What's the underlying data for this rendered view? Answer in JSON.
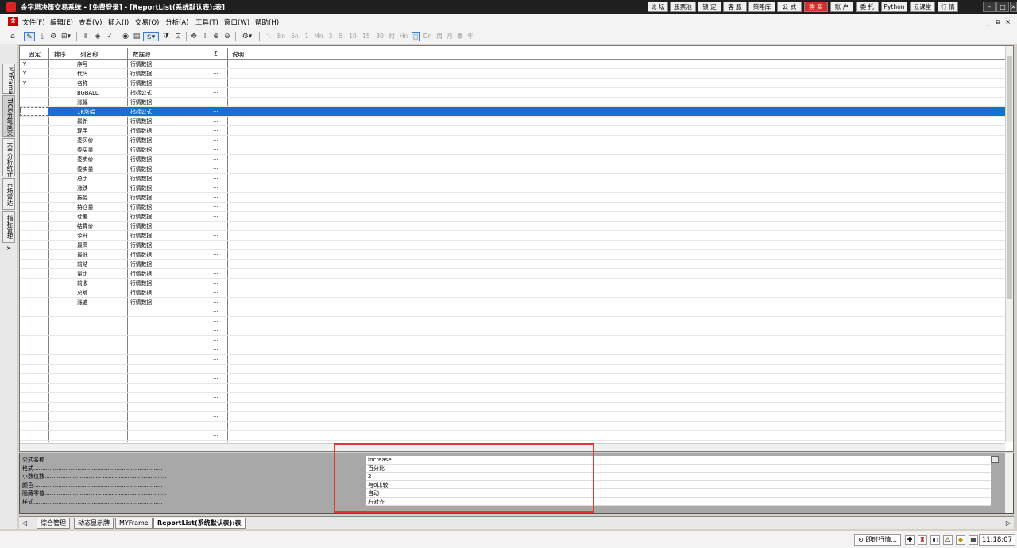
{
  "window": {
    "title": "金字塔决策交易系统 - [免费登录] - [ReportList(系统默认表):表]",
    "top_buttons": [
      "论 坛",
      "股票池",
      "锁 定",
      "客 服",
      "策略库",
      "公 式",
      "购 买",
      "账 户",
      "委 托",
      "Python",
      "云课堂",
      "行 情"
    ],
    "controls": [
      "–",
      "□",
      "×"
    ]
  },
  "menu": {
    "logo": "金",
    "items": [
      "文件(F)",
      "编辑(E)",
      "查看(V)",
      "插入(I)",
      "交易(O)",
      "分析(A)",
      "工具(T)",
      "窗口(W)",
      "帮助(H)"
    ],
    "mdi_controls": "_ ⧉ ×"
  },
  "toolbar": {
    "icons": [
      "home-icon",
      "pen-icon",
      "download-icon",
      "settings-icon",
      "grid-icon",
      "bar-icon",
      "target-icon",
      "check-icon",
      "play-icon",
      "doc-icon",
      "dollar-icon",
      "filter-icon",
      "table-icon",
      "move-icon",
      "line-icon",
      "zoom-in-icon",
      "zoom-out-icon",
      "gear-icon"
    ],
    "period_labels": [
      "Bn",
      "5n",
      "1",
      "Mn",
      "3",
      "5",
      "10",
      "15",
      "30",
      "时",
      "Hn",
      "日",
      "Dn",
      "周",
      "月",
      "季",
      "年"
    ]
  },
  "side_tabs": [
    "MYFrame",
    "TICK分笔成交",
    "大单分析统计",
    "市场雷达",
    "指标管理",
    "×"
  ],
  "grid": {
    "headers": [
      "固定",
      "排序",
      "列名称",
      "数据源",
      "Σ",
      "说明"
    ],
    "rows": [
      {
        "fixed": "Y",
        "name": "序号",
        "source": "行情数据",
        "sigma": "···"
      },
      {
        "fixed": "Y",
        "name": "代码",
        "source": "行情数据",
        "sigma": "···"
      },
      {
        "fixed": "Y",
        "name": "名称",
        "source": "行情数据",
        "sigma": "···"
      },
      {
        "fixed": "",
        "name": "BGBALL",
        "source": "指标公式",
        "sigma": "···"
      },
      {
        "fixed": "",
        "name": "涨幅",
        "source": "行情数据",
        "sigma": "···"
      },
      {
        "fixed": "",
        "name": "1K涨幅",
        "source": "指标公式",
        "sigma": "···",
        "selected": true
      },
      {
        "fixed": "",
        "name": "最新",
        "source": "行情数据",
        "sigma": "···"
      },
      {
        "fixed": "",
        "name": "现手",
        "source": "行情数据",
        "sigma": "···"
      },
      {
        "fixed": "",
        "name": "委买价",
        "source": "行情数据",
        "sigma": "···"
      },
      {
        "fixed": "",
        "name": "委买量",
        "source": "行情数据",
        "sigma": "···"
      },
      {
        "fixed": "",
        "name": "委卖价",
        "source": "行情数据",
        "sigma": "···"
      },
      {
        "fixed": "",
        "name": "委卖量",
        "source": "行情数据",
        "sigma": "···"
      },
      {
        "fixed": "",
        "name": "总手",
        "source": "行情数据",
        "sigma": "···"
      },
      {
        "fixed": "",
        "name": "涨跌",
        "source": "行情数据",
        "sigma": "···"
      },
      {
        "fixed": "",
        "name": "振幅",
        "source": "行情数据",
        "sigma": "···"
      },
      {
        "fixed": "",
        "name": "持仓量",
        "source": "行情数据",
        "sigma": "···"
      },
      {
        "fixed": "",
        "name": "仓差",
        "source": "行情数据",
        "sigma": "···"
      },
      {
        "fixed": "",
        "name": "结算价",
        "source": "行情数据",
        "sigma": "···"
      },
      {
        "fixed": "",
        "name": "今开",
        "source": "行情数据",
        "sigma": "···"
      },
      {
        "fixed": "",
        "name": "最高",
        "source": "行情数据",
        "sigma": "···"
      },
      {
        "fixed": "",
        "name": "最低",
        "source": "行情数据",
        "sigma": "···"
      },
      {
        "fixed": "",
        "name": "前结",
        "source": "行情数据",
        "sigma": "···"
      },
      {
        "fixed": "",
        "name": "量比",
        "source": "行情数据",
        "sigma": "···"
      },
      {
        "fixed": "",
        "name": "前收",
        "source": "行情数据",
        "sigma": "···"
      },
      {
        "fixed": "",
        "name": "总额",
        "source": "行情数据",
        "sigma": "···"
      },
      {
        "fixed": "",
        "name": "涨速",
        "source": "行情数据",
        "sigma": "···"
      },
      {
        "fixed": "",
        "name": "",
        "source": "",
        "sigma": "···"
      },
      {
        "fixed": "",
        "name": "",
        "source": "",
        "sigma": "···"
      },
      {
        "fixed": "",
        "name": "",
        "source": "",
        "sigma": "···"
      },
      {
        "fixed": "",
        "name": "",
        "source": "",
        "sigma": "···"
      },
      {
        "fixed": "",
        "name": "",
        "source": "",
        "sigma": "···"
      },
      {
        "fixed": "",
        "name": "",
        "source": "",
        "sigma": "···"
      },
      {
        "fixed": "",
        "name": "",
        "source": "",
        "sigma": "···"
      },
      {
        "fixed": "",
        "name": "",
        "source": "",
        "sigma": "···"
      },
      {
        "fixed": "",
        "name": "",
        "source": "",
        "sigma": "···"
      },
      {
        "fixed": "",
        "name": "",
        "source": "",
        "sigma": "···"
      },
      {
        "fixed": "",
        "name": "",
        "source": "",
        "sigma": "···"
      },
      {
        "fixed": "",
        "name": "",
        "source": "",
        "sigma": "···"
      },
      {
        "fixed": "",
        "name": "",
        "source": "",
        "sigma": "···"
      },
      {
        "fixed": "",
        "name": "",
        "source": "",
        "sigma": "···"
      },
      {
        "fixed": "",
        "name": "",
        "source": "",
        "sigma": "···"
      }
    ]
  },
  "properties": [
    {
      "label": "公式名称.....................................................................",
      "value": "Increase"
    },
    {
      "label": "格式.........................................................................",
      "value": "百分比"
    },
    {
      "label": "小数位数.....................................................................",
      "value": "2"
    },
    {
      "label": "颜色.........................................................................",
      "value": "与0比较"
    },
    {
      "label": "隐藏零值.....................................................................",
      "value": "自动"
    },
    {
      "label": "样式.........................................................................",
      "value": "右对齐"
    }
  ],
  "bottom_tabs": [
    "综合管理",
    "动态显示牌",
    "MYFrame",
    "ReportList(系统默认表):表"
  ],
  "status": {
    "quote": "⊙ 即时行情...",
    "time": "11:18:07"
  }
}
